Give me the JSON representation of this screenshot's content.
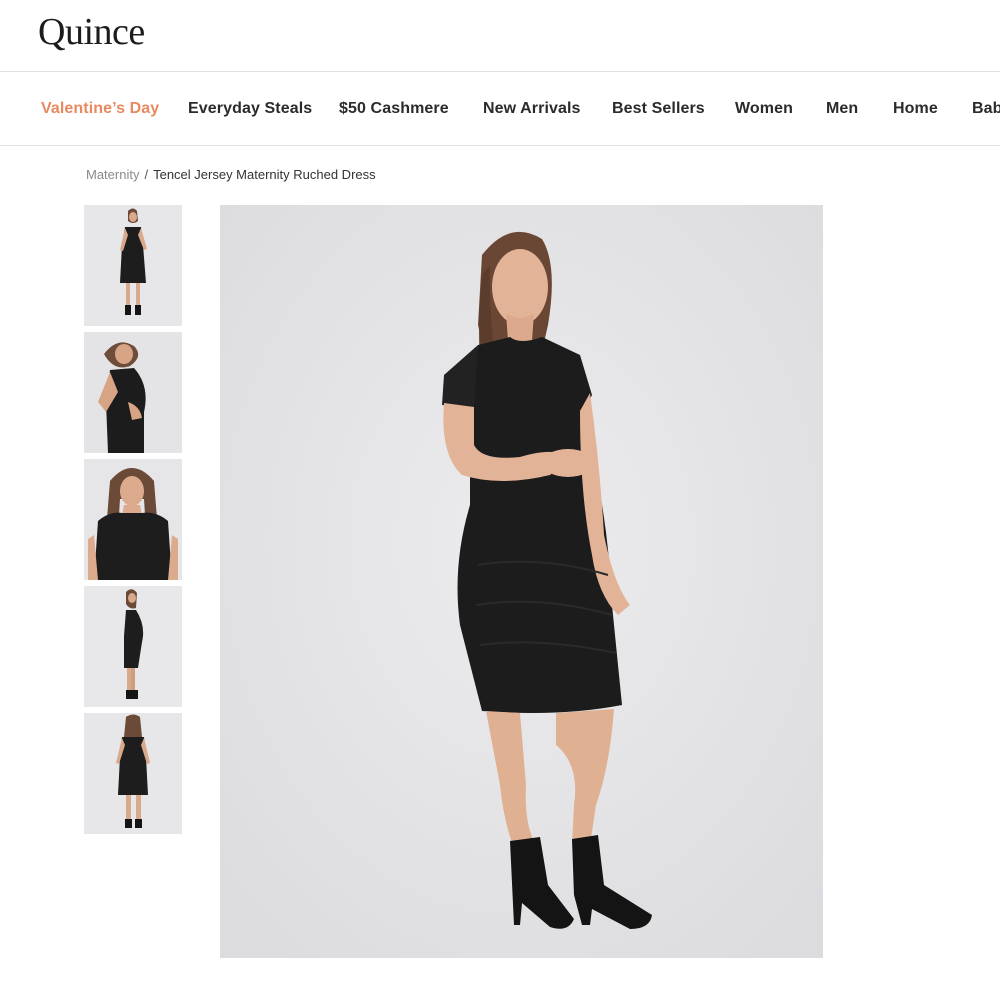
{
  "brand": {
    "logo_text": "Quince"
  },
  "nav": {
    "items": [
      {
        "label": "Valentine’s Day",
        "accent": true
      },
      {
        "label": "Everyday Steals"
      },
      {
        "label": "$50 Cashmere"
      },
      {
        "label": "New Arrivals"
      },
      {
        "label": "Best Sellers"
      },
      {
        "label": "Women"
      },
      {
        "label": "Men"
      },
      {
        "label": "Home"
      },
      {
        "label": "Baby"
      }
    ],
    "accent_color": "#e8895f"
  },
  "breadcrumb": {
    "parent": "Maternity",
    "separator": "/",
    "current": "Tencel Jersey Maternity Ruched Dress"
  },
  "gallery": {
    "thumbnail_count": 5,
    "thumbnail_icons": [
      "product-photo-front",
      "product-photo-side",
      "product-photo-closeup",
      "product-photo-profile",
      "product-photo-back"
    ],
    "main_image_icon": "product-photo-main"
  }
}
